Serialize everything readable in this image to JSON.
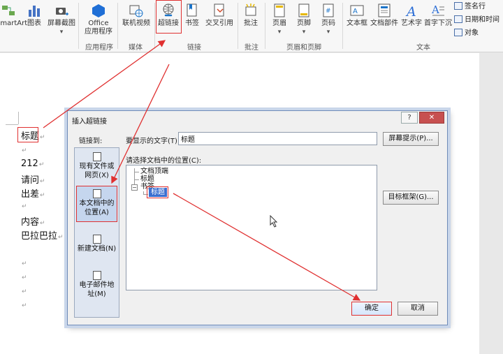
{
  "ribbon": {
    "buttons": {
      "smartart": "SmartArt",
      "chart": "图表",
      "screenshot": "屏幕截图",
      "office_line1": "Office",
      "office_line2": "应用程序",
      "online_video": "联机视频",
      "hyperlink": "超链接",
      "bookmark": "书签",
      "cross_reference": "交叉引用",
      "comment": "批注",
      "header": "页眉",
      "footer": "页脚",
      "page_number": "页码",
      "text_box": "文本框",
      "doc_parts": "文档部件",
      "wordart": "艺术字",
      "drop_cap": "首字下沉"
    },
    "small_items": {
      "signature_line": "签名行",
      "date_time": "日期和时间",
      "object": "对象"
    },
    "groups": {
      "apps": "应用程序",
      "media": "媒体",
      "links": "链接",
      "comments": "批注",
      "header_footer": "页眉和页脚",
      "text": "文本"
    }
  },
  "document": {
    "lines": [
      "标题",
      "",
      "212",
      "请问",
      "出差",
      "",
      "内容",
      "巴拉巴拉",
      "",
      "",
      "",
      ""
    ]
  },
  "dialog": {
    "title": "插入超链接",
    "help_glyph": "?",
    "close_glyph": "✕",
    "link_to_label": "链接到:",
    "link_options": {
      "existing_file": "现有文件或网页(X)",
      "place_in_doc": "本文档中的位置(A)",
      "new_doc": "新建文档(N)",
      "email": "电子邮件地址(M)"
    },
    "display_text_label": "要显示的文字(T):",
    "display_text_value": "标题",
    "screen_tip_button": "屏幕提示(P)...",
    "place_label": "请选择文档中的位置(C):",
    "tree": {
      "top_of_doc": "文档顶端",
      "headings": "标题",
      "bookmarks": "书签",
      "selected_bookmark": "标题"
    },
    "target_frame_button": "目标框架(G)...",
    "ok_button": "确定",
    "cancel_button": "取消"
  },
  "colors": {
    "annotation": "#e03030",
    "selection": "#3b6fd0"
  }
}
